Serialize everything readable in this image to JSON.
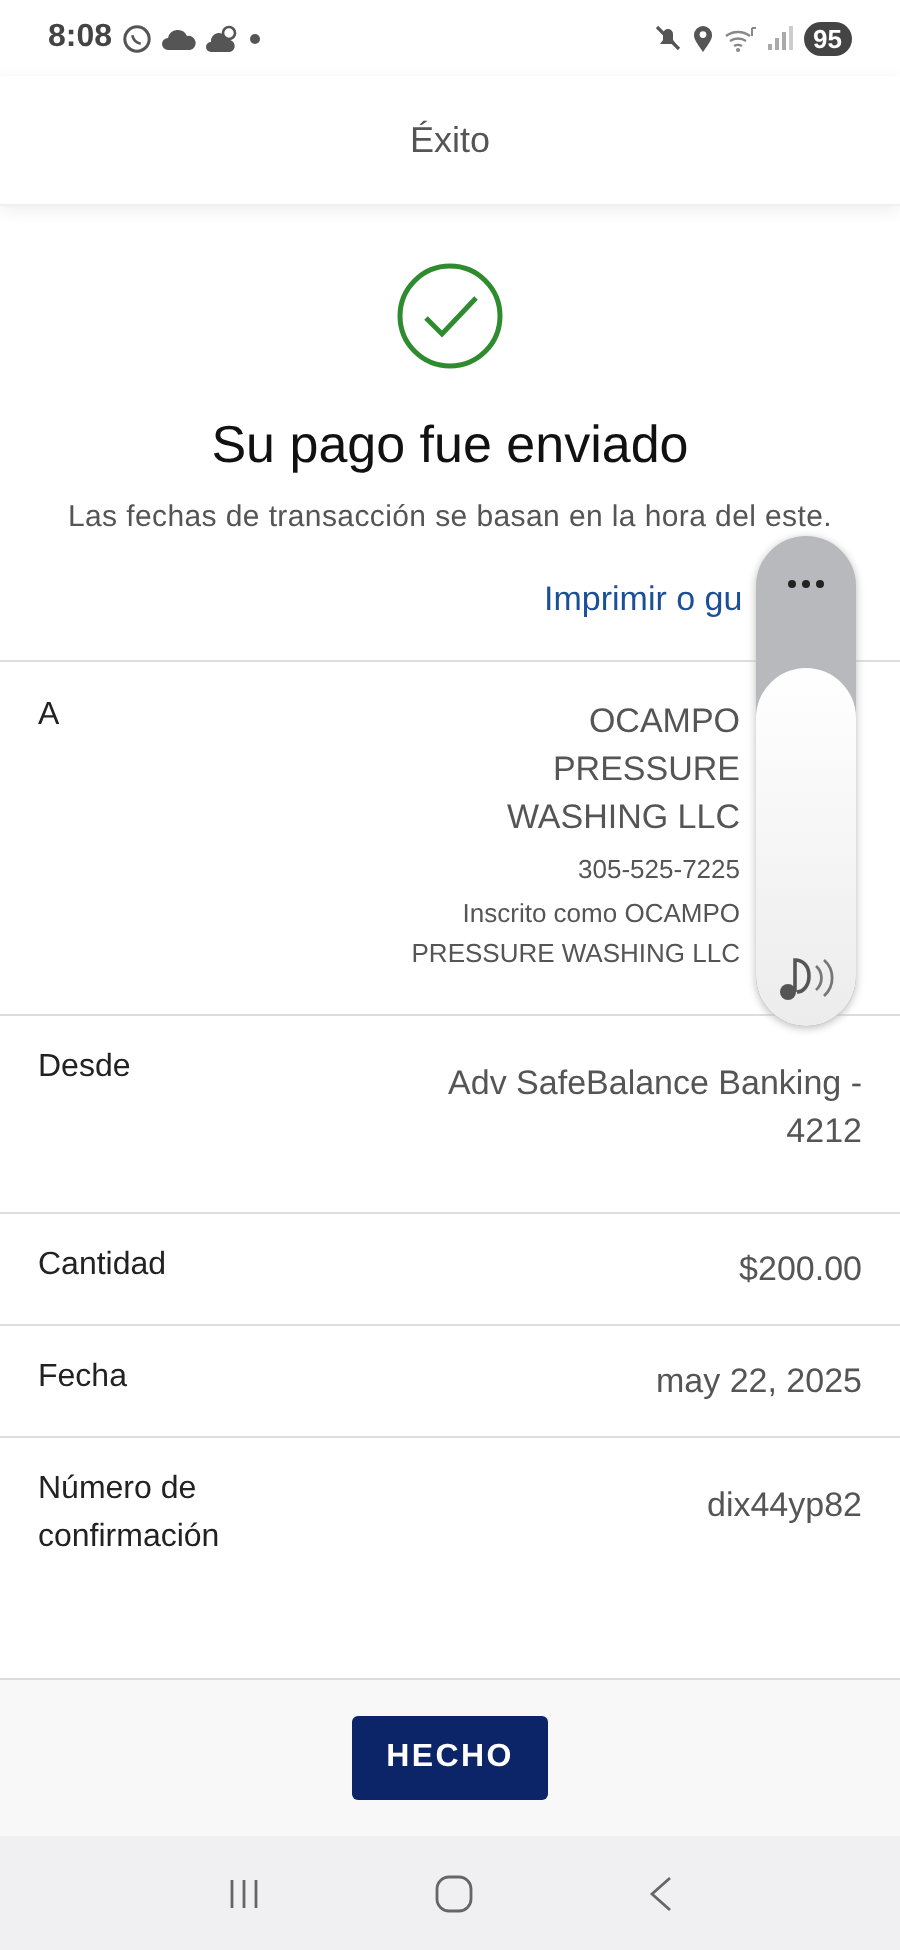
{
  "status_bar": {
    "time": "8:08",
    "battery": "95"
  },
  "header": {
    "title": "Éxito"
  },
  "confirmation": {
    "title": "Su pago fue enviado",
    "note": "Las fechas de transacción se basan en la hora del este.",
    "link": "Imprimir o gu"
  },
  "recipient": {
    "label": "A",
    "name": "OCAMPO PRESSURE WASHING LLC",
    "phone": "305-525-7225",
    "enrolled": "Inscrito como OCAMPO PRESSURE WASHING LLC"
  },
  "details": [
    {
      "label": "Desde",
      "value": "Adv SafeBalance Banking - 4212"
    },
    {
      "label": "Cantidad",
      "value": "$200.00"
    },
    {
      "label": "Fecha",
      "value": "may 22, 2025"
    },
    {
      "label": "Número de confirmación",
      "value": "dix44yp82"
    }
  ],
  "footer": {
    "button": "HECHO"
  },
  "volume_panel": {
    "level": 0.73
  }
}
